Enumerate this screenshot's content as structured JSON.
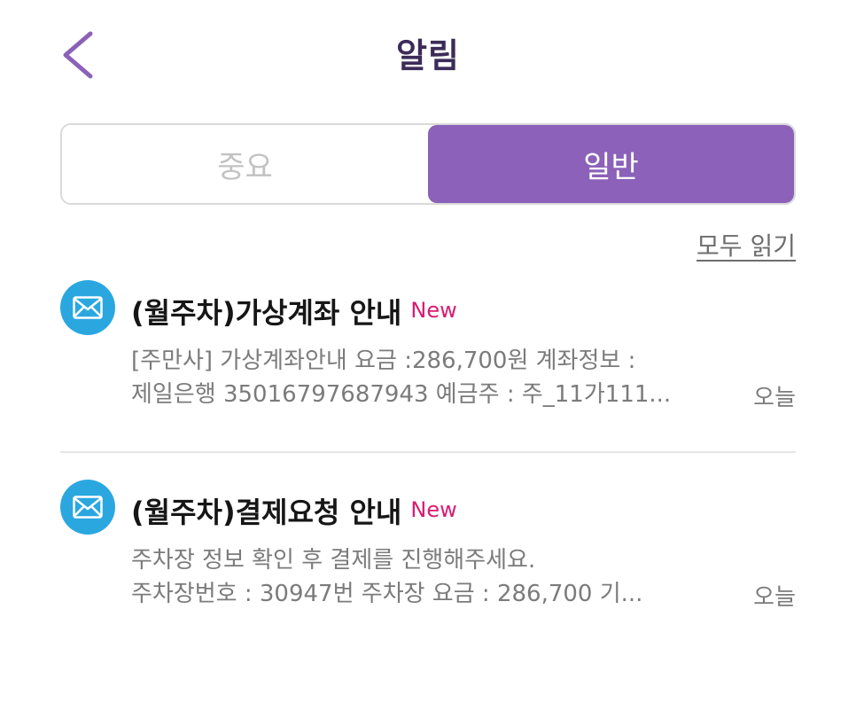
{
  "header": {
    "title": "알림",
    "back_icon": "chevron-left-icon"
  },
  "colors": {
    "accent": "#8b61b9",
    "title": "#3c2b59",
    "new_badge": "#d81b72",
    "mail_icon_bg": "#2ba7e0"
  },
  "tabs": [
    {
      "label": "중요",
      "active": false
    },
    {
      "label": "일반",
      "active": true
    }
  ],
  "read_all_label": "모두 읽기",
  "notifications": [
    {
      "icon": "mail-icon",
      "title": "(월주차)가상계좌 안내",
      "badge": "New",
      "line1": "[주만사] 가상계좌안내 요금 :286,700원 계좌정보 :",
      "line2": "제일은행 35016797687943 예금주 : 주_11가111...",
      "date": "오늘"
    },
    {
      "icon": "mail-icon",
      "title": "(월주차)결제요청 안내",
      "badge": "New",
      "line1": "주차장 정보 확인 후 결제를 진행해주세요.",
      "line2": "주차장번호 : 30947번 주차장 요금 : 286,700 기...",
      "date": "오늘"
    }
  ]
}
